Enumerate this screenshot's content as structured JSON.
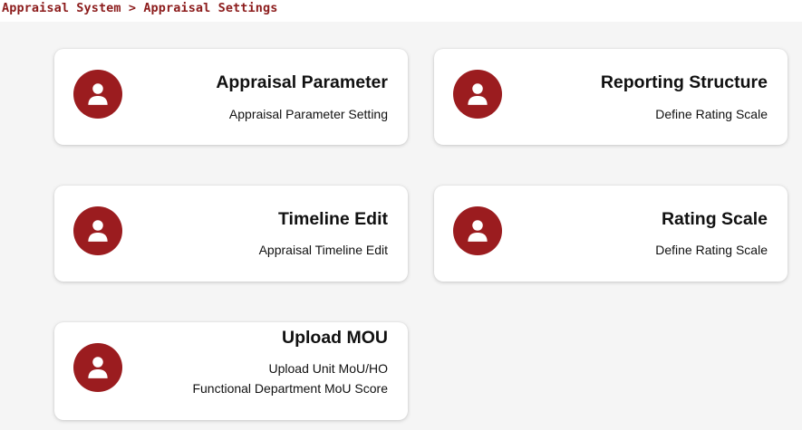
{
  "breadcrumb": "Appraisal System > Appraisal Settings",
  "accent_color": "#9b1c1f",
  "cards": [
    {
      "title": "Appraisal Parameter",
      "subtitles": [
        "Appraisal Parameter Setting"
      ],
      "icon": "user-icon"
    },
    {
      "title": "Reporting Structure",
      "subtitles": [
        "Define Rating Scale"
      ],
      "icon": "user-icon"
    },
    {
      "title": "Timeline Edit",
      "subtitles": [
        "Appraisal Timeline Edit"
      ],
      "icon": "user-icon"
    },
    {
      "title": "Rating Scale",
      "subtitles": [
        "Define Rating Scale"
      ],
      "icon": "user-icon"
    },
    {
      "title": "Upload MOU",
      "subtitles": [
        "Upload Unit MoU/HO",
        "Functional Department MoU Score"
      ],
      "icon": "user-icon"
    }
  ]
}
